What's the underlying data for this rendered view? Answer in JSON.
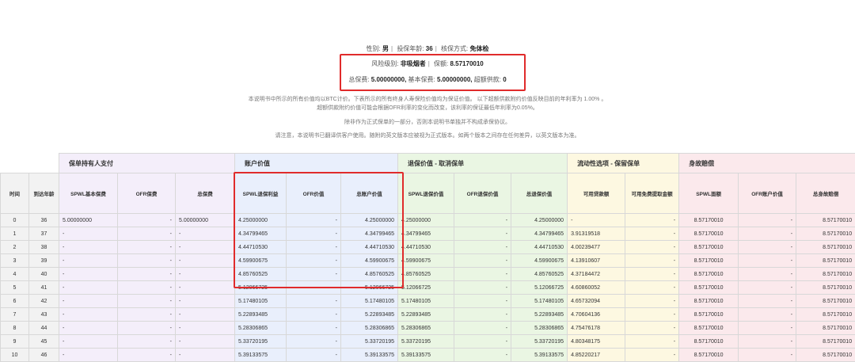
{
  "summary": {
    "line1": {
      "gender_label": "性别:",
      "gender": "男",
      "age_label": "投保年龄:",
      "age": "36",
      "method_label": "核保方式:",
      "method": "免体检"
    },
    "line2": {
      "risk_label": "风险级别:",
      "risk": "非吸烟者",
      "coverage_label": "保额:",
      "coverage": "8.57170010"
    },
    "line3": {
      "total_label": "总保费:",
      "total": "5.00000000,",
      "base_label": "基本保费:",
      "base": "5.00000000,",
      "excess_label": "超额供款:",
      "excess": "0"
    }
  },
  "notes": [
    "本说明书中所示的所有价值均以BTC计价。下表所示的所有终身人寿保险价值均为保证价值。 以下超额供款附约价值反映目前的年利率为 1.00% 。",
    "超额供款附约价值可能会根据OFR利率的变化而改变，该利率的保证最低年利率为0.05%。",
    "除非作为正式保单的一部分，否则本说明书单独并不构成承保协议。",
    "请注意，本说明书已翻译供客户使用。随附的英文版本应被视为正式版本。如两个版本之间存在任何差异，以英文版本为准。"
  ],
  "table": {
    "groups": [
      "保单持有人支付",
      "账户价值",
      "退保价值 - 取消保单",
      "流动性选项 - 保留保单",
      "身故赔偿"
    ],
    "headers": [
      "时间",
      "到达年龄",
      "SPWL基本保费",
      "OFR保费",
      "总保费",
      "SPWL退保利益",
      "OFR价值",
      "总账户价值",
      "SPWL退保价值",
      "OFR退保价值",
      "总退保价值",
      "可用贷款额",
      "可用免费提取金额",
      "SPWL面额",
      "OFR账户价值",
      "总身故赔偿"
    ],
    "rows": [
      [
        "0",
        "36",
        "5.00000000",
        "-",
        "5.00000000",
        "4.25000000",
        "-",
        "4.25000000",
        "4.25000000",
        "-",
        "4.25000000",
        "-",
        "-",
        "8.57170010",
        "-",
        "8.57170010"
      ],
      [
        "1",
        "37",
        "-",
        "-",
        "-",
        "4.34799465",
        "-",
        "4.34799465",
        "4.34799465",
        "-",
        "4.34799465",
        "3.91319518",
        "-",
        "8.57170010",
        "-",
        "8.57170010"
      ],
      [
        "2",
        "38",
        "-",
        "-",
        "-",
        "4.44710530",
        "-",
        "4.44710530",
        "4.44710530",
        "-",
        "4.44710530",
        "4.00239477",
        "-",
        "8.57170010",
        "-",
        "8.57170010"
      ],
      [
        "3",
        "39",
        "-",
        "-",
        "-",
        "4.59900675",
        "-",
        "4.59900675",
        "4.59900675",
        "-",
        "4.59900675",
        "4.13910607",
        "-",
        "8.57170010",
        "-",
        "8.57170010"
      ],
      [
        "4",
        "40",
        "-",
        "-",
        "-",
        "4.85760525",
        "-",
        "4.85760525",
        "4.85760525",
        "-",
        "4.85760525",
        "4.37184472",
        "-",
        "8.57170010",
        "-",
        "8.57170010"
      ],
      [
        "5",
        "41",
        "-",
        "-",
        "-",
        "5.12066725",
        "-",
        "5.12066725",
        "5.12066725",
        "-",
        "5.12066725",
        "4.60860052",
        "-",
        "8.57170010",
        "-",
        "8.57170010"
      ],
      [
        "6",
        "42",
        "-",
        "-",
        "-",
        "5.17480105",
        "-",
        "5.17480105",
        "5.17480105",
        "-",
        "5.17480105",
        "4.65732094",
        "-",
        "8.57170010",
        "-",
        "8.57170010"
      ],
      [
        "7",
        "43",
        "-",
        "-",
        "-",
        "5.22893485",
        "-",
        "5.22893485",
        "5.22893485",
        "-",
        "5.22893485",
        "4.70604136",
        "-",
        "8.57170010",
        "-",
        "8.57170010"
      ],
      [
        "8",
        "44",
        "-",
        "-",
        "-",
        "5.28306865",
        "-",
        "5.28306865",
        "5.28306865",
        "-",
        "5.28306865",
        "4.75476178",
        "-",
        "8.57170010",
        "-",
        "8.57170010"
      ],
      [
        "9",
        "45",
        "-",
        "-",
        "-",
        "5.33720195",
        "-",
        "5.33720195",
        "5.33720195",
        "-",
        "5.33720195",
        "4.80348175",
        "-",
        "8.57170010",
        "-",
        "8.57170010"
      ],
      [
        "10",
        "46",
        "-",
        "-",
        "-",
        "5.39133575",
        "-",
        "5.39133575",
        "5.39133575",
        "-",
        "5.39133575",
        "4.85220217",
        "-",
        "8.57170010",
        "-",
        "8.57170010"
      ]
    ]
  },
  "colors": {
    "highlight_box": "#e02b2b",
    "group_policyholder": "#f4eefa",
    "group_account": "#e9effc",
    "group_surrender": "#eaf6e3",
    "group_liquidity": "#fdf8e1",
    "group_death": "#fbe9ec"
  }
}
